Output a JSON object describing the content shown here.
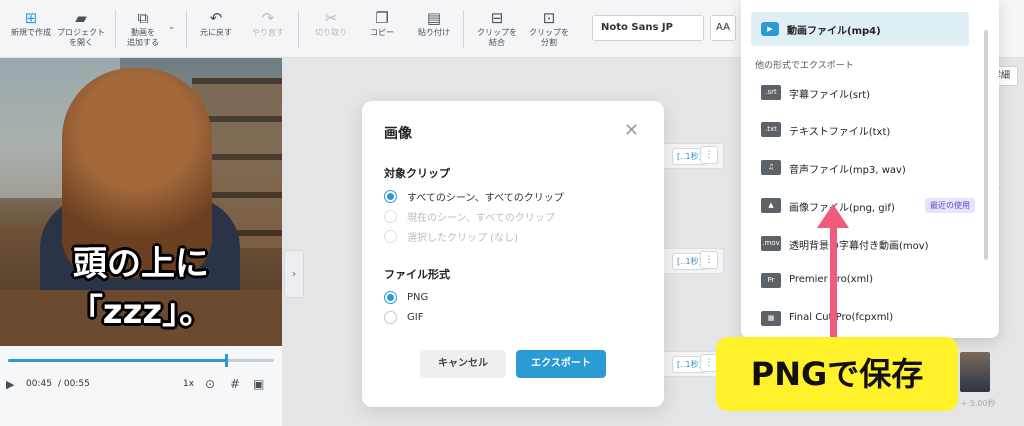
{
  "toolbar": {
    "new_project": "新規で作成",
    "open_project": "プロジェクト\nを開く",
    "add_video": "動画を\n追加する",
    "undo": "元に戻す",
    "redo": "やり直す",
    "cut": "切り取り",
    "copy": "コピー",
    "paste": "貼り付け",
    "merge_clip": "クリップを\n結合",
    "split_clip": "クリップを\n分割",
    "font": "Noto Sans JP",
    "aa": "AA"
  },
  "preview": {
    "caption_line1": "頭の上に",
    "caption_line2": "「zzz」。"
  },
  "player": {
    "current_time": "00:45",
    "total_time": "/ 00:55",
    "speed": "1x",
    "progress": 0.82
  },
  "timeline": {
    "clip_time": "[‥1秒]",
    "detail": "詳細",
    "right_note": "秒",
    "bottom_note": "秒 + 5.00秒"
  },
  "dialog": {
    "title": "画像",
    "close": "✕",
    "target_label": "対象クリップ",
    "target_options": [
      {
        "label": "すべてのシーン、すべてのクリップ"
      },
      {
        "label": "現在のシーン、すべてのクリップ"
      },
      {
        "label": "選択したクリップ (なし)"
      }
    ],
    "format_label": "ファイル形式",
    "format_options": [
      {
        "label": "PNG"
      },
      {
        "label": "GIF"
      }
    ],
    "cancel": "キャンセル",
    "export": "エクスポート"
  },
  "export_menu": {
    "primary": "動画ファイル(mp4)",
    "other_heading": "他の形式でエクスポート",
    "items": [
      {
        "icon": ".srt",
        "label": "字幕ファイル(srt)"
      },
      {
        "icon": ".txt",
        "label": "テキストファイル(txt)"
      },
      {
        "icon": "♫",
        "label": "音声ファイル(mp3, wav)"
      },
      {
        "icon": "▲",
        "label": "画像ファイル(png, gif)",
        "badge": "最近の使用"
      },
      {
        "icon": ".mov",
        "label": "透明背景の字幕付き動画(mov)"
      },
      {
        "icon": "Pr",
        "label": "Premier Pro(xml)"
      },
      {
        "icon": "▦",
        "label": "Final Cut Pro(fcpxml)"
      }
    ]
  },
  "annotation": {
    "callout": "PNGで保存",
    "color": "#ee5c7d"
  }
}
